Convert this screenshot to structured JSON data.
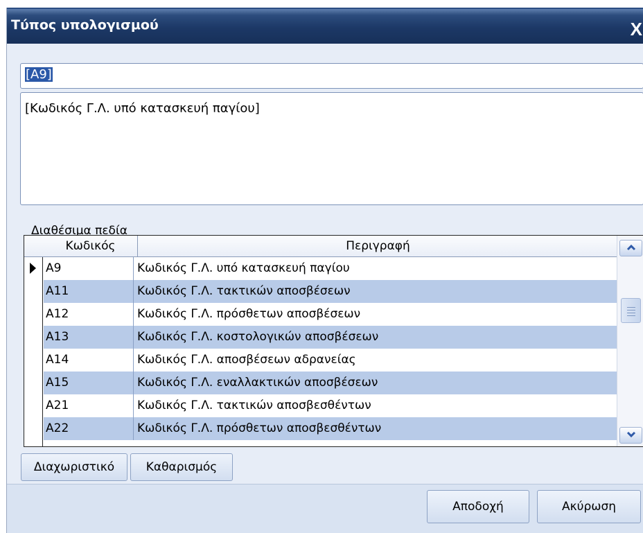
{
  "window": {
    "title": "Τύπος υπολογισμού",
    "close_glyph": "X"
  },
  "formula": {
    "value": "[A9]"
  },
  "description": {
    "value": "[Κωδικός Γ.Λ. υπό κατασκευή παγίου]"
  },
  "fields": {
    "label": "Διαθέσιμα πεδία",
    "columns": {
      "code": "Κωδικός",
      "description": "Περιγραφή"
    },
    "rows": [
      {
        "code": "A9",
        "description": "Κωδικός Γ.Λ. υπό κατασκευή παγίου"
      },
      {
        "code": "A11",
        "description": "Κωδικός Γ.Λ. τακτικών αποσβέσεων"
      },
      {
        "code": "A12",
        "description": "Κωδικός Γ.Λ. πρόσθετων αποσβέσεων"
      },
      {
        "code": "A13",
        "description": "Κωδικός Γ.Λ. κοστολογικών αποσβέσεων"
      },
      {
        "code": "A14",
        "description": "Κωδικός Γ.Λ. αποσβέσεων αδρανείας"
      },
      {
        "code": "A15",
        "description": "Κωδικός Γ.Λ. εναλλακτικών αποσβέσεων"
      },
      {
        "code": "A21",
        "description": "Κωδικός Γ.Λ. τακτικών αποσβεσθέντων"
      },
      {
        "code": "A22",
        "description": "Κωδικός Γ.Λ. πρόσθετων αποσβεσθέντων"
      }
    ],
    "selected_index": 0
  },
  "buttons": {
    "separator": "Διαχωριστικό",
    "clear": "Καθαρισμός",
    "accept": "Αποδοχή",
    "cancel": "Ακύρωση"
  },
  "colors": {
    "title_bar": "#1c3866",
    "alt_row": "#b8cbe8",
    "selection": "#2a58a8"
  },
  "icons": {
    "close": "close-icon",
    "row_pointer": "row-pointer-icon",
    "scroll_up": "chevron-up-icon",
    "scroll_down": "chevron-down-icon"
  }
}
